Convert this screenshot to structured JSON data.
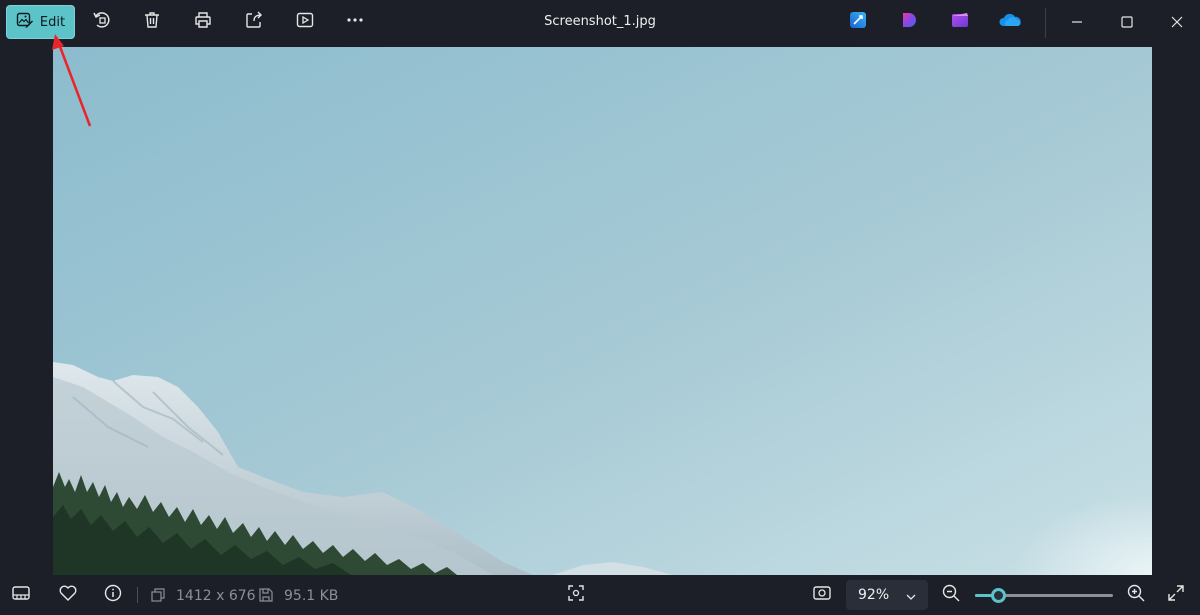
{
  "toolbar": {
    "edit_label": "Edit",
    "icons": [
      "edit-image-icon",
      "rotate-icon",
      "delete-icon",
      "print-icon",
      "share-icon",
      "slideshow-icon",
      "more-icon"
    ]
  },
  "window": {
    "title": "Screenshot_1.jpg",
    "app_icons": [
      "designer-icon",
      "clipchamp-d-icon",
      "clipchamp-icon",
      "onedrive-icon"
    ],
    "controls": [
      "minimize-icon",
      "maximize-icon",
      "close-icon"
    ]
  },
  "status": {
    "dimensions": "1412 x 676",
    "file_size": "95.1 KB",
    "zoom": "92%",
    "zoom_level": 0.17
  },
  "colors": {
    "accent": "#5cc3c9",
    "background": "#1c1f27",
    "annotation_arrow": "#e8262a"
  }
}
